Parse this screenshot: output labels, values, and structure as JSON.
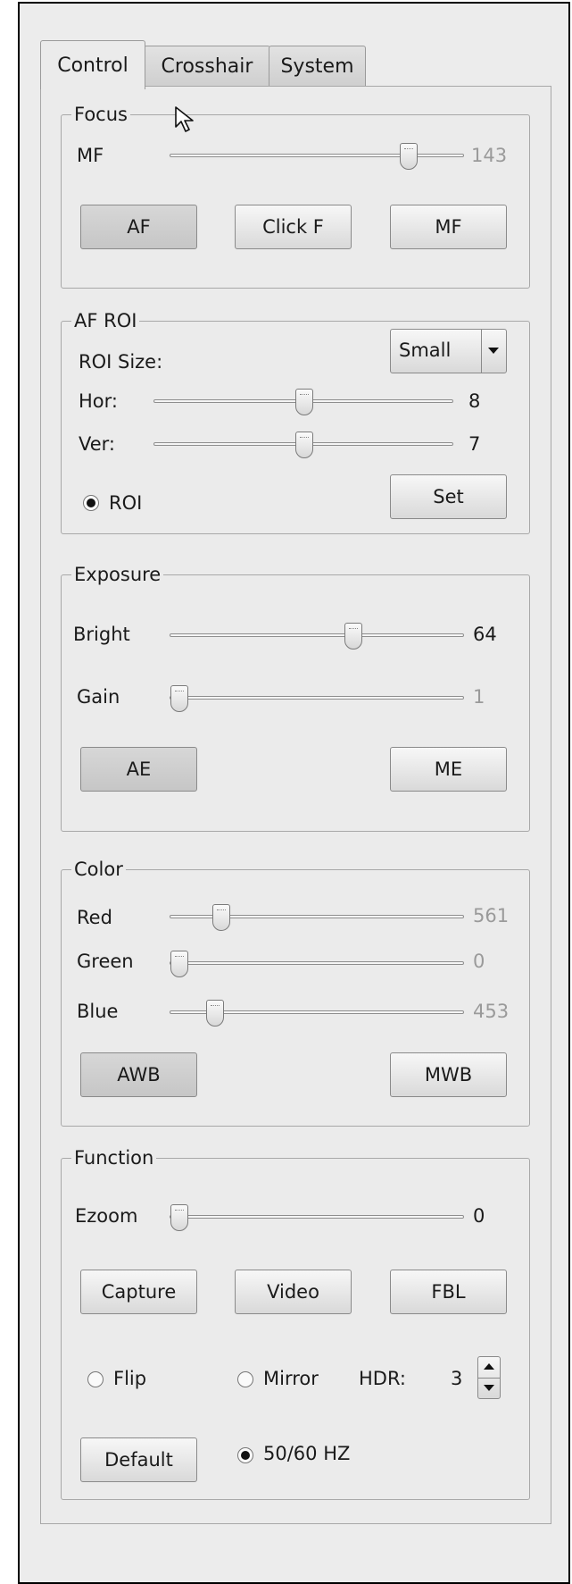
{
  "tabs": [
    {
      "label": "Control",
      "active": true
    },
    {
      "label": "Crosshair",
      "active": false
    },
    {
      "label": "System",
      "active": false
    }
  ],
  "focus": {
    "title": "Focus",
    "slider": {
      "label": "MF",
      "value": "143",
      "position": 0.83
    },
    "buttons": {
      "af": "AF",
      "click_f": "Click F",
      "mf": "MF"
    }
  },
  "af_roi": {
    "title": "AF ROI",
    "roi_size_label": "ROI Size:",
    "roi_size_value": "Small",
    "hor": {
      "label": "Hor:",
      "value": "8",
      "position": 0.5
    },
    "ver": {
      "label": "Ver:",
      "value": "7",
      "position": 0.5
    },
    "roi_radio_label": "ROI",
    "set_button": "Set"
  },
  "exposure": {
    "title": "Exposure",
    "bright": {
      "label": "Bright",
      "value": "64",
      "position": 0.63
    },
    "gain": {
      "label": "Gain",
      "value": "1",
      "position": 0.0
    },
    "ae_button": "AE",
    "me_button": "ME"
  },
  "color": {
    "title": "Color",
    "red": {
      "label": "Red",
      "value": "561",
      "position": 0.15
    },
    "green": {
      "label": "Green",
      "value": "0",
      "position": 0.0
    },
    "blue": {
      "label": "Blue",
      "value": "453",
      "position": 0.13
    },
    "awb_button": "AWB",
    "mwb_button": "MWB"
  },
  "function": {
    "title": "Function",
    "ezoom": {
      "label": "Ezoom",
      "value": "0",
      "position": 0.0
    },
    "capture_button": "Capture",
    "video_button": "Video",
    "fbl_button": "FBL",
    "flip_label": "Flip",
    "mirror_label": "Mirror",
    "hdr_label": "HDR:",
    "hdr_value": "3",
    "default_button": "Default",
    "hz_label": "50/60 HZ"
  },
  "icons": {
    "cursor": "mouse-pointer-icon",
    "combo_arrow": "chevron-down-icon",
    "spin_up": "arrow-up-icon",
    "spin_down": "arrow-down-icon"
  }
}
